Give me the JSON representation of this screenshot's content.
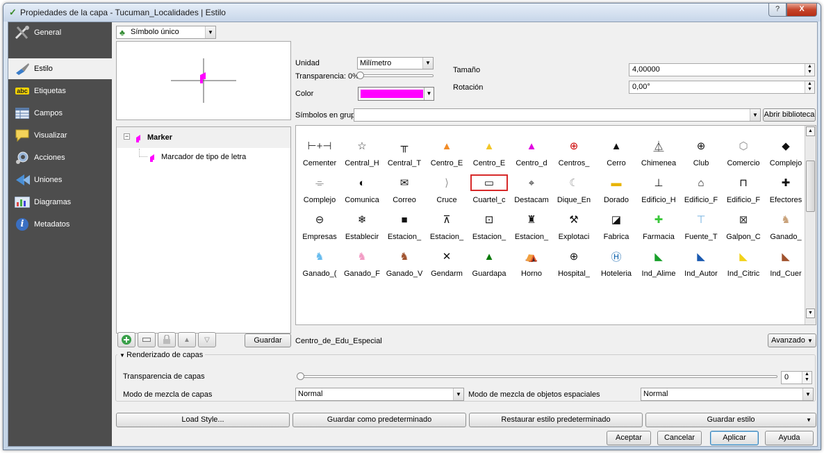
{
  "window": {
    "title": "Propiedades de la capa - Tucuman_Localidades | Estilo",
    "help_btn": "?",
    "close_btn": "X"
  },
  "sidebar": {
    "items": [
      {
        "label": "General",
        "icon": "tools-icon"
      },
      {
        "label": "Estilo",
        "icon": "paintbrush-icon"
      },
      {
        "label": "Etiquetas",
        "icon": "abc-label-icon",
        "icon_text": "abc"
      },
      {
        "label": "Campos",
        "icon": "table-icon"
      },
      {
        "label": "Visualizar",
        "icon": "speech-bubble-icon"
      },
      {
        "label": "Acciones",
        "icon": "gear-icon"
      },
      {
        "label": "Uniones",
        "icon": "join-icon"
      },
      {
        "label": "Diagramas",
        "icon": "chart-icon"
      },
      {
        "label": "Metadatos",
        "icon": "info-icon",
        "icon_text": "i"
      }
    ],
    "active_index": 1
  },
  "renderer": {
    "value": "Símbolo único"
  },
  "tree": {
    "root_label": "Marker",
    "child_label": "Marcador de tipo de letra",
    "expand_glyph": "−"
  },
  "props": {
    "unit_label": "Unidad",
    "unit_value": "Milímetro",
    "transparency_label": "Transparencia: 0%",
    "color_label": "Color",
    "color_value": "#ff00ff",
    "size_label": "Tamaño",
    "size_value": "4,00000",
    "rotation_label": "Rotación",
    "rotation_value": "0,00°"
  },
  "group": {
    "label": "Símbolos en grupo",
    "value": "",
    "open_library": "Abrir biblioteca"
  },
  "symbols": {
    "rows": [
      {
        "glyphs": [
          "⊢+⊣",
          "☆",
          "╥",
          "▲",
          "▲",
          "▲",
          "⊕",
          "▲",
          "⏅",
          "⊕",
          "⬡",
          "◆"
        ],
        "colors": [
          "#333",
          "#333",
          "#111",
          "#f28c28",
          "#f2c628",
          "#e000e0",
          "#cc0000",
          "#111",
          "#111",
          "#111",
          "#888",
          "#111"
        ],
        "labels": [
          "Cementer",
          "Central_H",
          "Central_T",
          "Centro_E",
          "Centro_E",
          "Centro_d",
          "Centros_",
          "Cerro",
          "Chimenea",
          "Club",
          "Comercio",
          "Complejo"
        ]
      },
      {
        "glyphs": [
          "⌯",
          "◐",
          "✉",
          "⟩",
          "▭",
          "⌖",
          "☾",
          "▬",
          "⊥",
          "⌂",
          "⊓",
          "✚"
        ],
        "colors": [
          "#333",
          "#111",
          "#111",
          "#999",
          "#111",
          "#111",
          "#999",
          "#e8b400",
          "#111",
          "#111",
          "#111",
          "#111"
        ],
        "labels": [
          "Complejo",
          "Comunica",
          "Correo",
          "Cruce",
          "Cuartel_c",
          "Destacam",
          "Dique_En",
          "Dorado",
          "Edificio_H",
          "Edificio_F",
          "Edificio_F",
          "Efectores"
        ]
      },
      {
        "glyphs": [
          "⊖",
          "❄",
          "■",
          "⊼",
          "⊡",
          "♜",
          "⚒",
          "◪",
          "✚",
          "⊤",
          "⊠",
          "♞"
        ],
        "colors": [
          "#111",
          "#111",
          "#111",
          "#111",
          "#111",
          "#111",
          "#111",
          "#111",
          "#3cc83c",
          "#66aadd",
          "#333",
          "#c9a27a"
        ],
        "labels": [
          "Empresas",
          "Establecir",
          "Estacion_",
          "Estacion_",
          "Estacion_",
          "Estacion_",
          "Explotaci",
          "Fabrica",
          "Farmacia",
          "Fuente_T",
          "Galpon_C",
          "Ganado_"
        ]
      },
      {
        "glyphs": [
          "♞",
          "♞",
          "♞",
          "✕",
          "▲",
          "⛺",
          "⊕",
          "Ⓗ",
          "◣",
          "◣",
          "◣",
          "◣"
        ],
        "colors": [
          "#66bbee",
          "#f29bc4",
          "#a0522d",
          "#111",
          "#0a7a0a",
          "#111",
          "#111",
          "#1a6ab0",
          "#18a02a",
          "#1a5ab0",
          "#f2d21a",
          "#a0522d"
        ],
        "labels": [
          "Ganado_(",
          "Ganado_F",
          "Ganado_V",
          "Gendarm",
          "Guardapa",
          "Horno",
          "Hospital_",
          "Hoteleria",
          "Ind_Alime",
          "Ind_Autor",
          "Ind_Citric",
          "Ind_Cuer"
        ]
      }
    ],
    "selected_row": 1,
    "selected_col": 4
  },
  "bottom_tools": {
    "save_label": "Guardar",
    "selected_name": "Centro_de_Edu_Especial",
    "advanced_label": "Avanzado"
  },
  "layer_rendering": {
    "title": "Renderizado de capas",
    "transparency_label": "Transparencia de capas",
    "transparency_value": "0",
    "blend_label": "Modo de mezcla de capas",
    "blend_value": "Normal",
    "feature_blend_label": "Modo de mezcla de objetos espaciales",
    "feature_blend_value": "Normal"
  },
  "style_buttons": {
    "load": "Load Style...",
    "save_default": "Guardar como predeterminado",
    "restore_default": "Restaurar estilo predeterminado",
    "save_style": "Guardar estilo"
  },
  "dialog_buttons": {
    "ok": "Aceptar",
    "cancel": "Cancelar",
    "apply": "Aplicar",
    "help": "Ayuda"
  }
}
